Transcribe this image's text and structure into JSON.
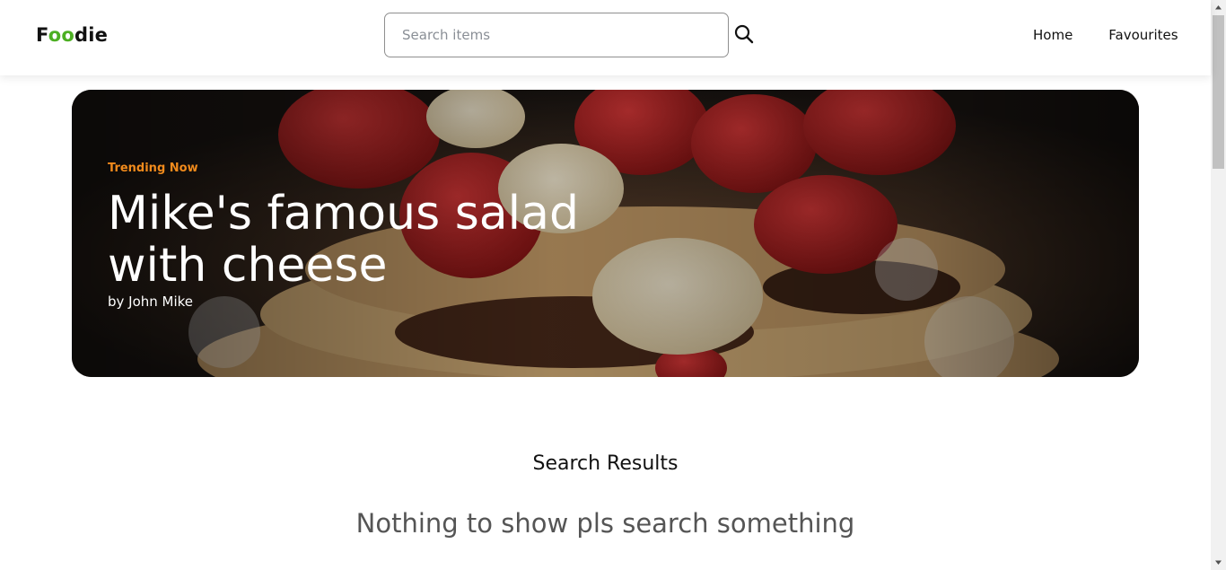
{
  "header": {
    "logo": {
      "part1": "F",
      "part2": "oo",
      "part3": "die"
    },
    "search": {
      "placeholder": "Search items",
      "value": ""
    },
    "nav": [
      {
        "label": "Home"
      },
      {
        "label": "Favourites"
      }
    ]
  },
  "hero": {
    "tag": "Trending Now",
    "title": "Mike's famous salad with cheese",
    "author": "by John Mike"
  },
  "results": {
    "title": "Search Results",
    "empty_message": "Nothing to show pls search something"
  },
  "colors": {
    "logo_accent": "#4caf22",
    "trending": "#f08a1c"
  },
  "icons": [
    "search-icon"
  ]
}
